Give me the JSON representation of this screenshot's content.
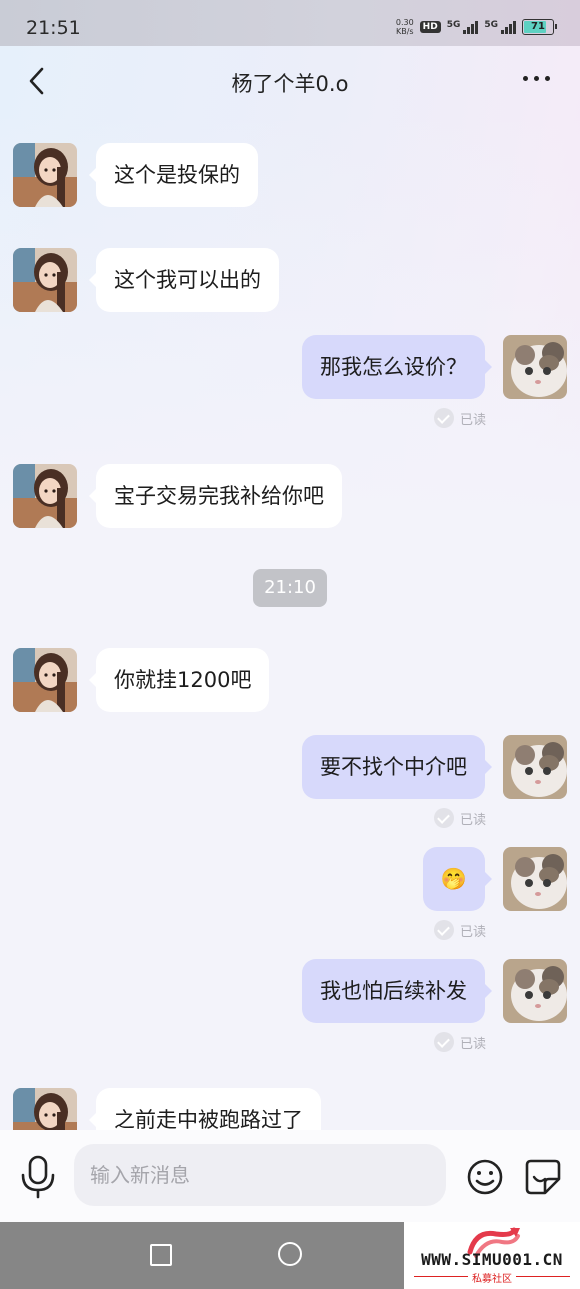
{
  "status_bar": {
    "time": "21:51",
    "net_speed_value": "0.30",
    "net_speed_unit": "KB/s",
    "hd_label": "HD",
    "sim1_label": "5G",
    "sim2_label": "5G",
    "battery": "71"
  },
  "header": {
    "title": "杨了个羊0.o"
  },
  "messages": [
    {
      "side": "in",
      "text": "这个是投保的"
    },
    {
      "side": "in",
      "text": "这个我可以出的"
    },
    {
      "side": "out",
      "text": "那我怎么设价？",
      "status": "已读"
    },
    {
      "side": "in",
      "text": "宝子交易完我补给你吧"
    },
    {
      "type": "timestamp",
      "text": "21:10"
    },
    {
      "side": "in",
      "text": "你就挂1200吧"
    },
    {
      "side": "out",
      "text": "要不找个中介吧",
      "status": "已读"
    },
    {
      "side": "out",
      "emoji": "🤭",
      "status": "已读"
    },
    {
      "side": "out",
      "text": "我也怕后续补发",
      "status": "已读"
    },
    {
      "side": "in",
      "text": "之前走中被跑路过了"
    }
  ],
  "input_bar": {
    "placeholder": "输入新消息"
  },
  "watermark": {
    "site": "WWW.SIMU001.CN",
    "sub": "私募社区"
  },
  "colors": {
    "outgoing_bubble": "#d7d9fb",
    "incoming_bubble": "#ffffff",
    "timestamp_pill": "#c2c3c8"
  }
}
